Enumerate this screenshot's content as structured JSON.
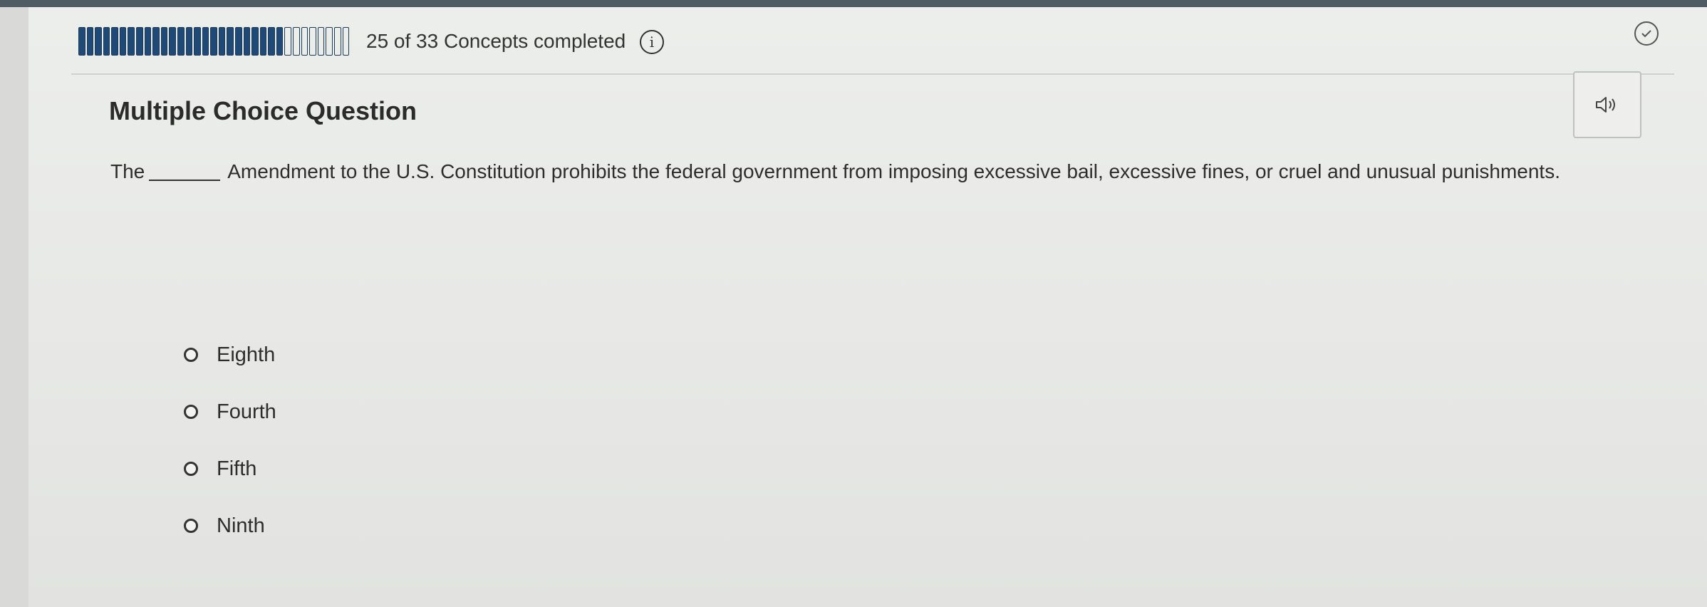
{
  "progress": {
    "completed": 25,
    "total": 33,
    "text": "25 of 33 Concepts completed"
  },
  "icons": {
    "info": "info-icon",
    "check": "check-circle-icon",
    "audio": "speaker-icon"
  },
  "question": {
    "title": "Multiple Choice Question",
    "text_before_blank": "The",
    "text_after_blank": "Amendment to the U.S. Constitution prohibits the federal government from imposing excessive bail, excessive fines, or cruel and unusual punishments."
  },
  "options": [
    {
      "label": "Eighth"
    },
    {
      "label": "Fourth"
    },
    {
      "label": "Fifth"
    },
    {
      "label": "Ninth"
    }
  ],
  "colors": {
    "progress_fill": "#1f4a78",
    "text": "#2d2d2d"
  }
}
